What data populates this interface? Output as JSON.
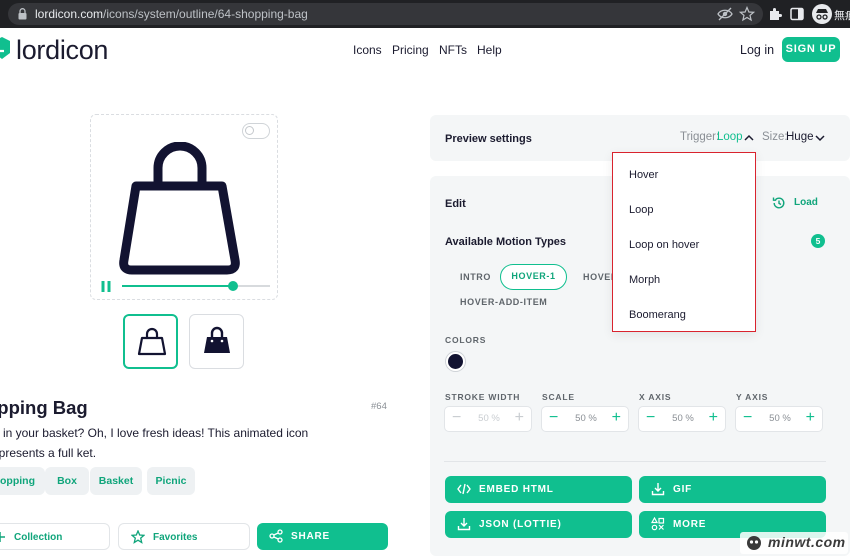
{
  "browser": {
    "url_host": "lordicon.com",
    "url_path": "/icons/system/outline/64-shopping-bag",
    "profile_name": "無痕"
  },
  "header": {
    "logo": "lordicon",
    "nav": [
      "Icons",
      "Pricing",
      "NFTs",
      "Help"
    ],
    "login": "Log in",
    "signup": "SIGN UP"
  },
  "icon": {
    "title": "opping Bag",
    "number": "#64",
    "description": "t's in your basket? Oh, I love fresh ideas! This animated icon represents a full ket.",
    "progress": 0.75,
    "tags": [
      "opping",
      "Box",
      "Basket",
      "Picnic"
    ],
    "buttons": {
      "collection": "Collection",
      "favorites": "Favorites",
      "share": "SHARE"
    }
  },
  "preview_settings": {
    "label": "Preview settings",
    "trigger_label": "Trigger:",
    "trigger_value": "Loop",
    "size_label": "Size:",
    "size_value": "Huge"
  },
  "edit": {
    "label": "Edit",
    "load": "Load",
    "motion_types_label": "Available Motion Types",
    "motion_count": "5",
    "motion_tabs": [
      "INTRO",
      "HOVER-1",
      "HOVER-",
      "HOVER-ADD-ITEM"
    ],
    "colors_label": "COLORS",
    "color_swatch": "#121331",
    "controls": [
      {
        "label": "STROKE WIDTH",
        "value": "50 %",
        "enabled": false
      },
      {
        "label": "SCALE",
        "value": "50 %",
        "enabled": true
      },
      {
        "label": "X AXIS",
        "value": "50 %",
        "enabled": true
      },
      {
        "label": "Y AXIS",
        "value": "50 %",
        "enabled": true
      }
    ],
    "actions": {
      "embed": "EMBED HTML",
      "gif": "GIF",
      "json": "JSON (LOTTIE)",
      "more": "MORE"
    }
  },
  "trigger_dropdown": [
    "Hover",
    "Loop",
    "Loop on hover",
    "Morph",
    "Boomerang"
  ],
  "watermark": "minwt.com",
  "colors": {
    "accent": "#10bf8f",
    "ink": "#121331",
    "highlight": "#d9232e"
  }
}
